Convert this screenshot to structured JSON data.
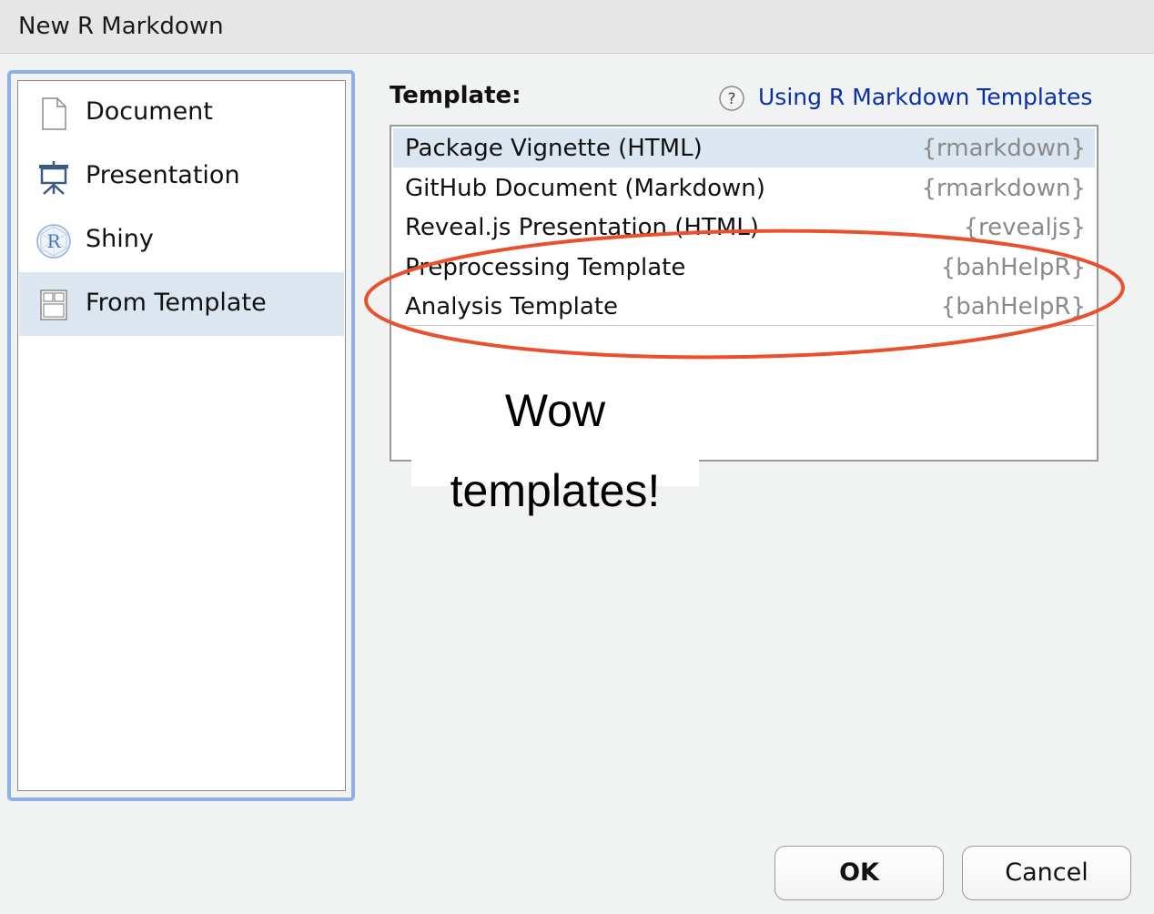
{
  "window": {
    "title": "New R Markdown"
  },
  "sidebar": {
    "items": [
      {
        "label": "Document",
        "icon": "document-icon",
        "selected": false
      },
      {
        "label": "Presentation",
        "icon": "presentation-icon",
        "selected": false
      },
      {
        "label": "Shiny",
        "icon": "shiny-icon",
        "selected": false
      },
      {
        "label": "From Template",
        "icon": "template-icon",
        "selected": true
      }
    ]
  },
  "main": {
    "template_heading": "Template:",
    "help_icon": "help-icon",
    "help_link": "Using R Markdown Templates",
    "templates": [
      {
        "name": "Package Vignette (HTML)",
        "package": "{rmarkdown}",
        "selected": true
      },
      {
        "name": "GitHub Document (Markdown)",
        "package": "{rmarkdown}",
        "selected": false
      },
      {
        "name": "Reveal.js Presentation (HTML)",
        "package": "{revealjs}",
        "selected": false
      },
      {
        "name": "Preprocessing Template",
        "package": "{bahHelpR}",
        "selected": false
      },
      {
        "name": "Analysis Template",
        "package": "{bahHelpR}",
        "selected": false
      }
    ]
  },
  "annotation": {
    "line1": "Wow",
    "line2": "templates!",
    "ellipse_color": "#e8502e"
  },
  "buttons": {
    "ok": "OK",
    "cancel": "Cancel"
  },
  "colors": {
    "selection": "#dce6f1",
    "link": "#0a2fa8",
    "focus_ring": "#8fb0e4",
    "package_text": "#8a8a8a"
  }
}
